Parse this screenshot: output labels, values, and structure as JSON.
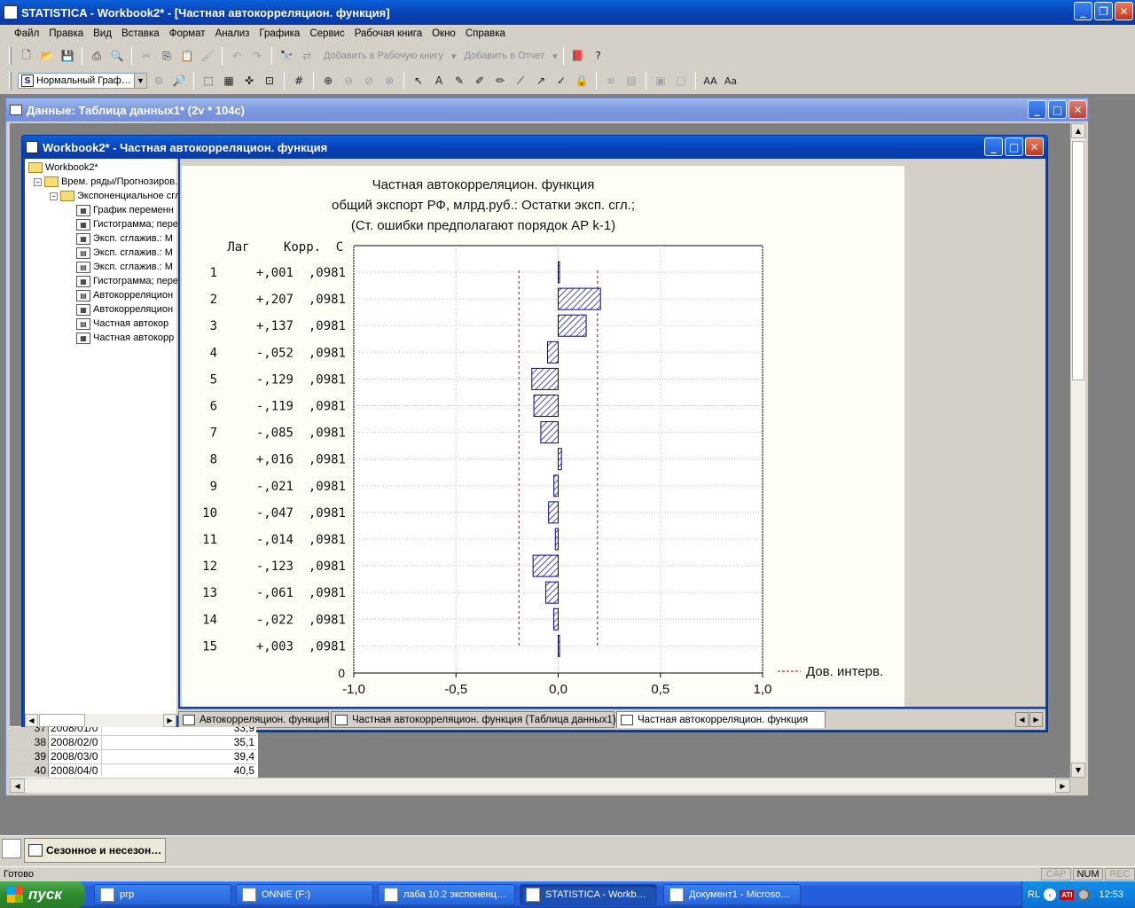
{
  "app": {
    "title": "STATISTICA - Workbook2* - [Частная автокорреляцион. функция]"
  },
  "menu": [
    "Файл",
    "Правка",
    "Вид",
    "Вставка",
    "Формат",
    "Анализ",
    "Графика",
    "Сервис",
    "Рабочая книга",
    "Окно",
    "Справка"
  ],
  "toolbar1": {
    "add_workbook": "Добавить в Рабочую книгу",
    "add_report": "Добавить в Отчет"
  },
  "toolbar2": {
    "graph_style": "Нормальный Граф…"
  },
  "data_window": {
    "title": "Данные: Таблица данных1* (2v * 104c)",
    "rows": [
      {
        "n": "37",
        "date": "2008/01/0",
        "val": "33,9"
      },
      {
        "n": "38",
        "date": "2008/02/0",
        "val": "35,1"
      },
      {
        "n": "39",
        "date": "2008/03/0",
        "val": "39,4"
      },
      {
        "n": "40",
        "date": "2008/04/0",
        "val": "40,5"
      }
    ]
  },
  "workbook": {
    "title": "Workbook2* - Частная автокорреляцион. функция",
    "tree": [
      {
        "label": "Workbook2*",
        "level": 0,
        "icon": "folder"
      },
      {
        "label": "Врем. ряды/Прогнозиров.",
        "level": 1,
        "icon": "folder"
      },
      {
        "label": "Экспоненциальное сгл",
        "level": 2,
        "icon": "folder"
      },
      {
        "label": "График переменн",
        "level": 3,
        "icon": "graph"
      },
      {
        "label": "Гистограмма; пере",
        "level": 3,
        "icon": "graph"
      },
      {
        "label": "Эксп. сглажив.: М",
        "level": 3,
        "icon": "graph"
      },
      {
        "label": "Эксп. сглажив.: М",
        "level": 3,
        "icon": "table"
      },
      {
        "label": "Эксп. сглажив.: М",
        "level": 3,
        "icon": "table"
      },
      {
        "label": "Гистограмма; пере",
        "level": 3,
        "icon": "graph"
      },
      {
        "label": "Автокорреляцион",
        "level": 3,
        "icon": "table"
      },
      {
        "label": "Автокорреляцион",
        "level": 3,
        "icon": "graph"
      },
      {
        "label": "Частная автокор",
        "level": 3,
        "icon": "table"
      },
      {
        "label": "Частная автокорр",
        "level": 3,
        "icon": "graph"
      }
    ],
    "tabs": [
      {
        "label": "Автокорреляцион. функция",
        "active": false
      },
      {
        "label": "Частная автокорреляцион. функция (Таблица данных1)",
        "active": false
      },
      {
        "label": "Частная автокорреляцион. функция",
        "active": true
      }
    ]
  },
  "chart_data": {
    "type": "bar",
    "orientation": "horizontal",
    "title": [
      "Частная автокорреляцион. функция",
      "общий экспорт РФ, млрд.руб.: Остатки эксп. сгл.;",
      "(Ст. ошибки предполагают порядок АР k-1)"
    ],
    "headers": {
      "lag": "Лаг",
      "corr": "Корр.",
      "se": "С"
    },
    "lags": [
      "1",
      "2",
      "3",
      "4",
      "5",
      "6",
      "7",
      "8",
      "9",
      "10",
      "11",
      "12",
      "13",
      "14",
      "15"
    ],
    "corr_labels": [
      "+,001",
      "+,207",
      "+,137",
      "-,052",
      "-,129",
      "-,119",
      "-,085",
      "+,016",
      "-,021",
      "-,047",
      "-,014",
      "-,123",
      "-,061",
      "-,022",
      "+,003"
    ],
    "se_labels": [
      ",0981",
      ",0981",
      ",0981",
      ",0981",
      ",0981",
      ",0981",
      ",0981",
      ",0981",
      ",0981",
      ",0981",
      ",0981",
      ",0981",
      ",0981",
      ",0981",
      ",0981"
    ],
    "values": [
      0.001,
      0.207,
      0.137,
      -0.052,
      -0.129,
      -0.119,
      -0.085,
      0.016,
      -0.021,
      -0.047,
      -0.014,
      -0.123,
      -0.061,
      -0.022,
      0.003
    ],
    "confidence_limit": 0.1923,
    "xlim": [
      -1.0,
      1.0
    ],
    "x_ticks": [
      "-1,0",
      "-0,5",
      "0,0",
      "0,5",
      "1,0"
    ],
    "y_zero_label": "0",
    "legend": "Дов. интерв.",
    "grid": true,
    "bar_color": "#0000a8",
    "ci_color": "#c00000"
  },
  "minimized": {
    "label": "Сезонное и несезон…"
  },
  "status": {
    "text": "Готово",
    "indicators": [
      "CAP",
      "NUM",
      "REC"
    ]
  },
  "taskbar": {
    "start": "пуск",
    "items": [
      {
        "label": "ргр",
        "active": false
      },
      {
        "label": "ONNIE (F:)",
        "active": false
      },
      {
        "label": "лаба 10.2 экспоненц…",
        "active": false
      },
      {
        "label": "STATISTICA - Workb…",
        "active": true
      },
      {
        "label": "Документ1 - Microso…",
        "active": false
      }
    ],
    "lang": "RL",
    "clock": "12:53"
  }
}
